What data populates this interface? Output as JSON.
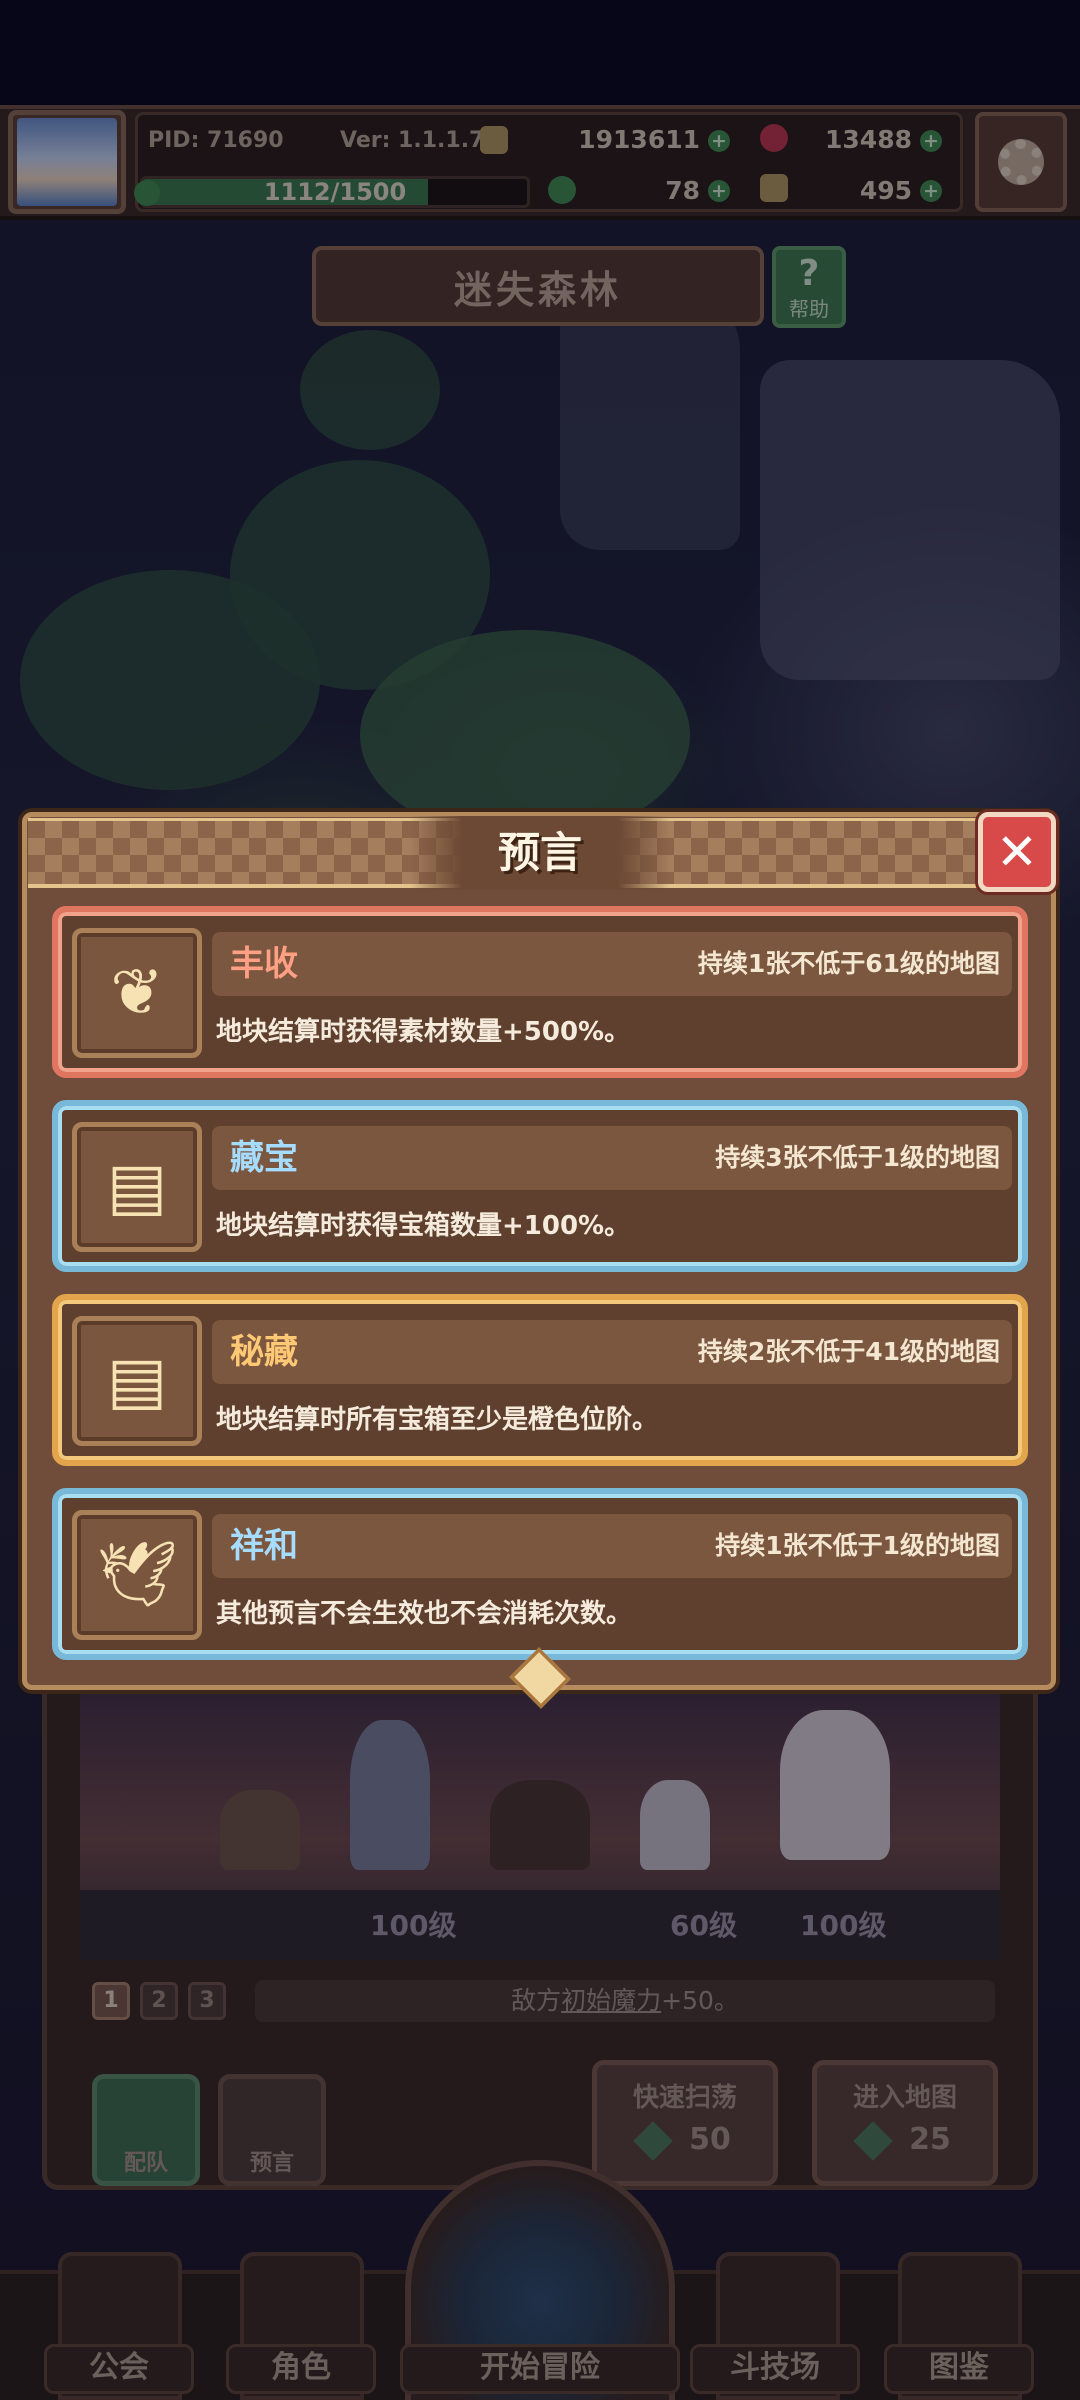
{
  "player": {
    "pid": "PID: 71690",
    "version": "Ver: 1.1.1.7",
    "gold": "1913611",
    "gems": "13488",
    "xp_text": "1112/1500",
    "xp_progress": 0.741,
    "clover": "78",
    "keys": "495"
  },
  "location": {
    "title": "迷失森林",
    "help_label": "帮助"
  },
  "modal": {
    "title": "预言",
    "prophecies": [
      {
        "name": "丰收",
        "duration": "持续1张不低于61级的地图",
        "desc": "地块结算时获得素材数量+500%。",
        "rarity": "red",
        "icon": "harvest-icon"
      },
      {
        "name": "藏宝",
        "duration": "持续3张不低于1级的地图",
        "desc": "地块结算时获得宝箱数量+100%。",
        "rarity": "blue",
        "icon": "scroll-icon"
      },
      {
        "name": "秘藏",
        "duration": "持续2张不低于41级的地图",
        "desc": "地块结算时所有宝箱至少是橙色位阶。",
        "rarity": "gold",
        "icon": "scroll-icon"
      },
      {
        "name": "祥和",
        "duration": "持续1张不低于1级的地图",
        "desc": "其他预言不会生效也不会消耗次数。",
        "rarity": "blue",
        "icon": "dove-icon"
      }
    ]
  },
  "stage": {
    "levels": [
      "100级",
      "60级",
      "100级"
    ],
    "tabs": [
      "1",
      "2",
      "3"
    ],
    "enemy_desc_prefix": "敌方",
    "enemy_desc_term": "初始魔力",
    "enemy_desc_suffix": "+50。",
    "buttons": {
      "team": "配队",
      "prophecy": "预言",
      "sweep": "快速扫荡",
      "sweep_cost": "50",
      "enter": "进入地图",
      "enter_cost": "25"
    }
  },
  "nav": {
    "guild": "公会",
    "character": "角色",
    "adventure": "开始冒险",
    "arena": "斗技场",
    "codex": "图鉴"
  },
  "colors": {
    "red_frame": "#e07560",
    "blue_frame": "#78b8d8",
    "gold_frame": "#e2a54c",
    "close_button": "#d8494a"
  }
}
